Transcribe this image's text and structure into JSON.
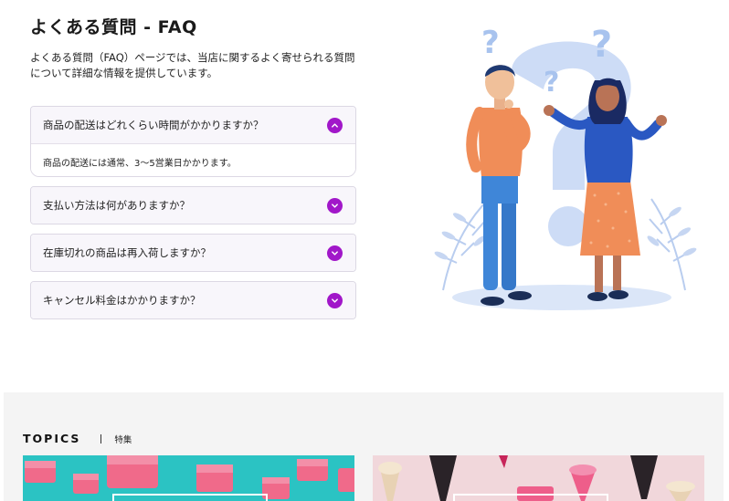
{
  "faq": {
    "title": "よくある質問 - FAQ",
    "description": "よくある質問（FAQ）ページでは、当店に関するよく寄せられる質問について詳細な情報を提供しています。",
    "items": [
      {
        "question": "商品の配送はどれくらい時間がかかりますか？",
        "answer": "商品の配送には通常、3〜5営業日かかります。",
        "open": true,
        "toggle_icon": "chevron-up-icon"
      },
      {
        "question": "支払い方法は何がありますか？",
        "open": false,
        "toggle_icon": "chevron-down-icon"
      },
      {
        "question": "在庫切れの商品は再入荷しますか？",
        "open": false,
        "toggle_icon": "chevron-down-icon"
      },
      {
        "question": "キャンセル料金はかかりますか？",
        "open": false,
        "toggle_icon": "chevron-down-icon"
      }
    ],
    "accent_color": "#a117c9"
  },
  "illustration": {
    "icon": "faq-people-illustration"
  },
  "topics": {
    "title": "TOPICS",
    "subtitle": "特集",
    "cards": [
      {
        "icon": "pink-cake-cubes-image",
        "color": "#2bc3c3"
      },
      {
        "icon": "ice-cream-cones-image",
        "color": "#f1d7db"
      }
    ]
  }
}
